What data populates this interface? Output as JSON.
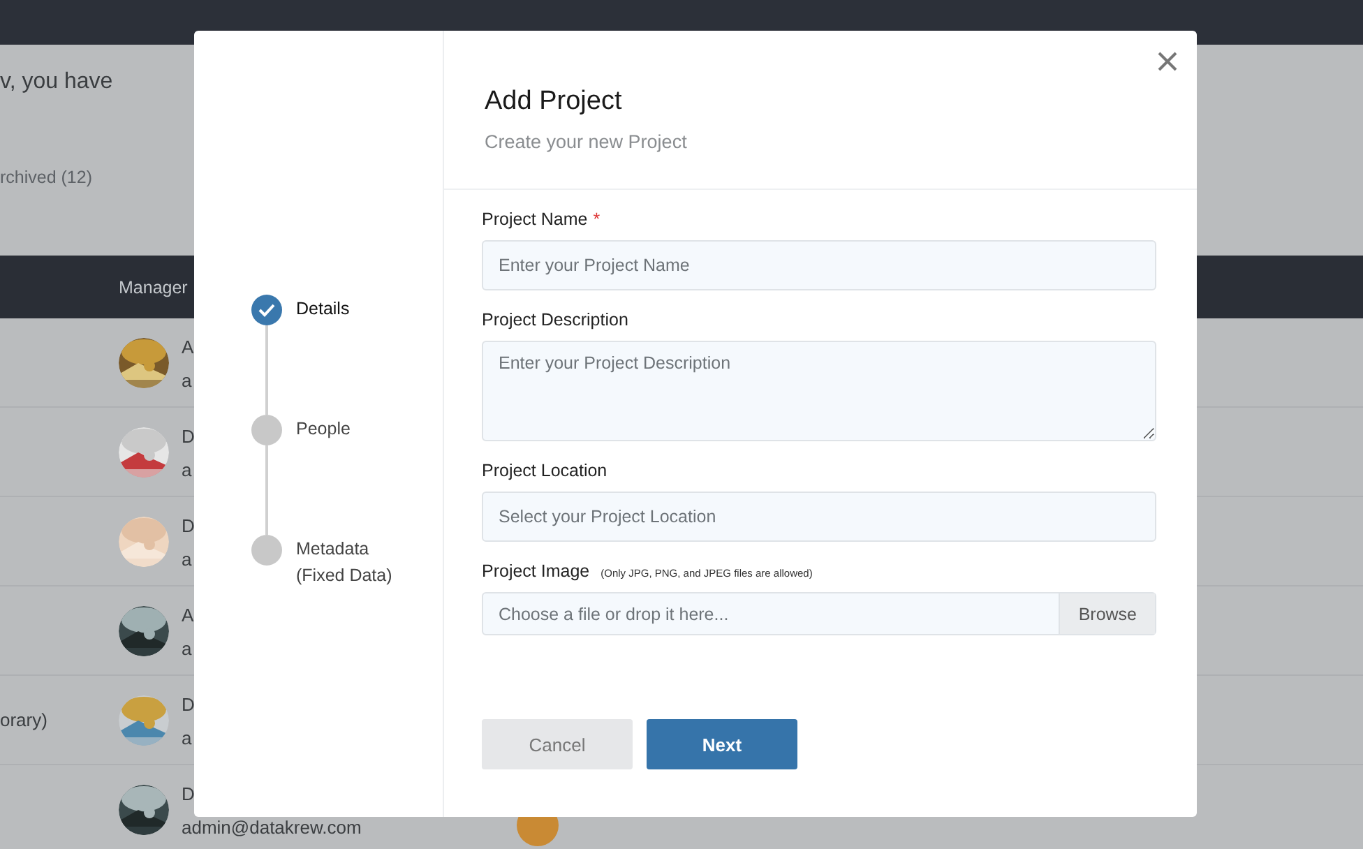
{
  "background": {
    "intro_text": "v, you have",
    "tab_text": "rchived (12)",
    "table_header": "Manager",
    "rows": [
      {
        "name": "A",
        "email": "a"
      },
      {
        "name": "D",
        "email": "a"
      },
      {
        "name": "D",
        "email": "a"
      },
      {
        "name": "A",
        "email": "a"
      },
      {
        "name": "D",
        "email": "a",
        "side_text": "orary)"
      },
      {
        "name": "D",
        "email": "admin@datakrew.com"
      }
    ]
  },
  "modal": {
    "title": "Add Project",
    "subtitle": "Create your new Project",
    "steps": [
      {
        "label": "Details",
        "done": true
      },
      {
        "label": "People",
        "done": false
      },
      {
        "label": "Metadata (Fixed Data)",
        "done": false
      }
    ],
    "fields": [
      {
        "kind": "text",
        "label": "Project Name",
        "required_mark": "*",
        "placeholder": "Enter your Project Name"
      },
      {
        "kind": "textarea",
        "label": "Project Description",
        "placeholder": "Enter your Project Description"
      },
      {
        "kind": "select",
        "label": "Project Location",
        "placeholder": "Select your Project Location"
      },
      {
        "kind": "file",
        "label": "Project Image",
        "hint": "(Only JPG, PNG, and JPEG files are allowed)",
        "placeholder": "Choose a file or drop it here...",
        "button_label": "Browse"
      }
    ],
    "buttons": [
      {
        "kind": "secondary",
        "label": "Cancel"
      },
      {
        "kind": "primary",
        "label": "Next"
      }
    ]
  }
}
